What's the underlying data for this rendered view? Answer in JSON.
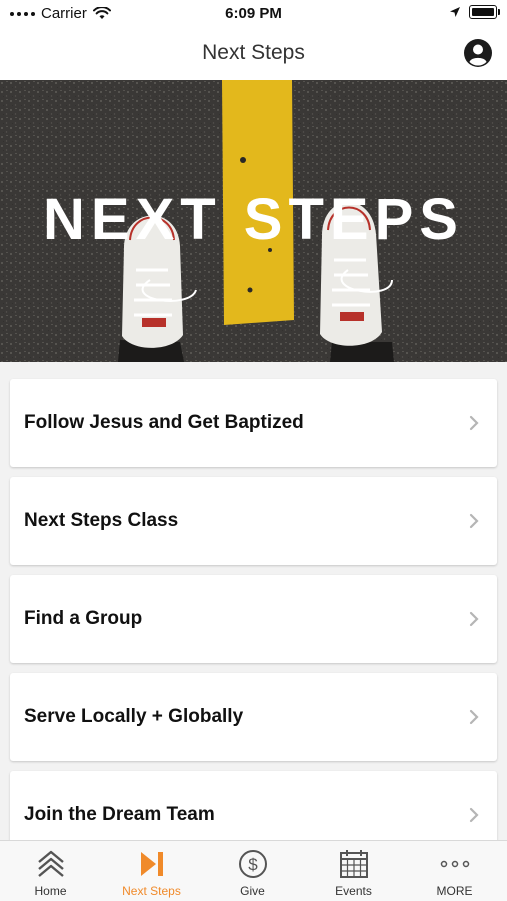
{
  "status": {
    "carrier": "Carrier",
    "time": "6:09 PM"
  },
  "nav": {
    "title": "Next Steps"
  },
  "hero": {
    "title": "NEXT STEPS"
  },
  "list": [
    {
      "label": "Follow Jesus and Get Baptized"
    },
    {
      "label": "Next Steps Class"
    },
    {
      "label": "Find a Group"
    },
    {
      "label": "Serve Locally + Globally"
    },
    {
      "label": "Join the Dream Team"
    }
  ],
  "tabs": [
    {
      "label": "Home",
      "icon": "home-chevrons-icon"
    },
    {
      "label": "Next Steps",
      "icon": "next-steps-icon",
      "active": true
    },
    {
      "label": "Give",
      "icon": "dollar-icon"
    },
    {
      "label": "Events",
      "icon": "calendar-icon"
    },
    {
      "label": "MORE",
      "icon": "more-dots-icon"
    }
  ],
  "colors": {
    "accent": "#f08a2a",
    "road_line": "#e3b81c",
    "asphalt": "#3a3836"
  }
}
